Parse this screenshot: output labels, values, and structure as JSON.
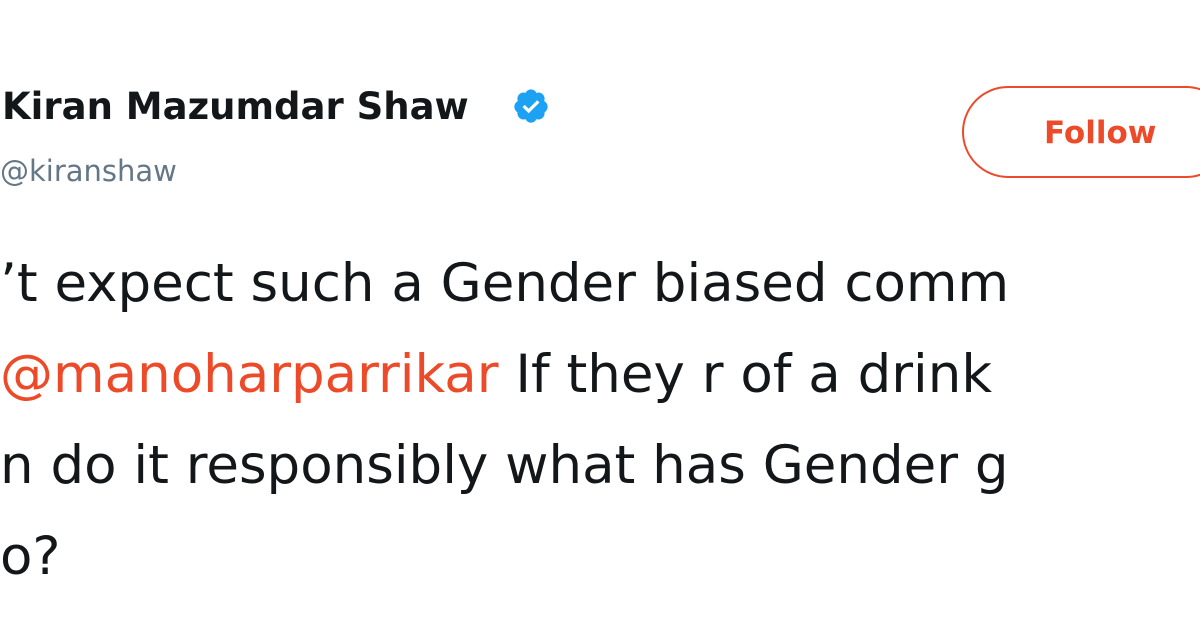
{
  "profile": {
    "name": "Kiran Mazumdar Shaw",
    "handle": "@kiranshaw",
    "verified": true
  },
  "follow_button": {
    "label": "Follow"
  },
  "tweet": {
    "line1": "’t expect such a Gender biased comm",
    "line2_mention": "@manoharparrikar",
    "line2_rest": " If they r of a drink",
    "line3": "n do it responsibly what has Gender g",
    "line4": "o?"
  },
  "colors": {
    "accent": "#ec4a28",
    "verified": "#1da1f2",
    "text": "#14171a",
    "secondary_text": "#657786"
  },
  "icons": {
    "verified": "verified-badge-icon"
  }
}
